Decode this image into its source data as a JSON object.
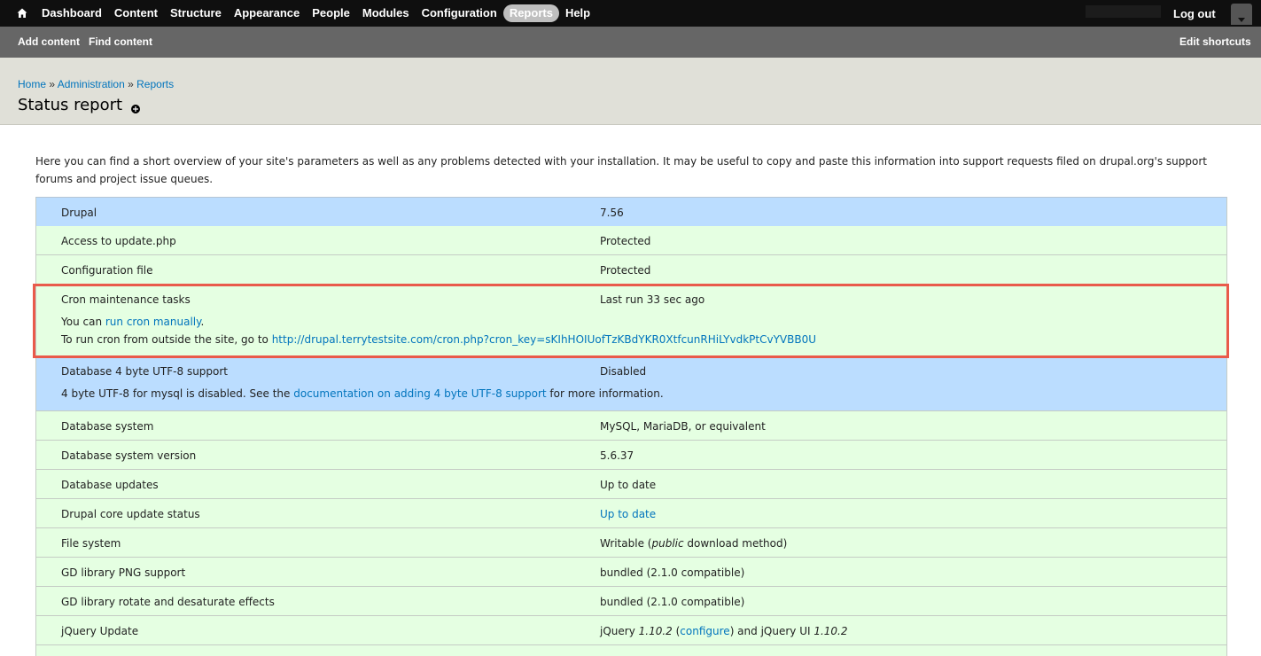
{
  "toolbar": {
    "menu": [
      "Dashboard",
      "Content",
      "Structure",
      "Appearance",
      "People",
      "Modules",
      "Configuration",
      "Reports",
      "Help"
    ],
    "active": "Reports",
    "logout": "Log out"
  },
  "shortcuts": {
    "add_content": "Add content",
    "find_content": "Find content",
    "edit_shortcuts": "Edit shortcuts"
  },
  "breadcrumb": {
    "home": "Home",
    "sep": "»",
    "administration": "Administration",
    "reports": "Reports"
  },
  "page_title": "Status report",
  "intro": "Here you can find a short overview of your site's parameters as well as any problems detected with your installation. It may be useful to copy and paste this information into support requests filed on drupal.org's support forums and project issue queues.",
  "rows": [
    {
      "title": "Drupal",
      "value": "7.56",
      "status": "info"
    },
    {
      "title": "Access to update.php",
      "value": "Protected",
      "status": "ok"
    },
    {
      "title": "Configuration file",
      "value": "Protected",
      "status": "ok"
    },
    {
      "title": "Cron maintenance tasks",
      "value": "Last run 33 sec ago",
      "status": "ok",
      "desc1_pre": "You can ",
      "desc1_link": "run cron manually",
      "desc1_post": ".",
      "desc2_pre": "To run cron from outside the site, go to ",
      "desc2_link": "http://drupal.terrytestsite.com/cron.php?cron_key=sKIhHOIUofTzKBdYKR0XtfcunRHiLYvdkPtCvYVBB0U"
    },
    {
      "title": "Database 4 byte UTF-8 support",
      "value": "Disabled",
      "status": "info",
      "desc_pre": "4 byte UTF-8 for mysql is disabled. See the ",
      "desc_link": "documentation on adding 4 byte UTF-8 support",
      "desc_post": " for more information."
    },
    {
      "title": "Database system",
      "value": "MySQL, MariaDB, or equivalent",
      "status": "ok"
    },
    {
      "title": "Database system version",
      "value": "5.6.37",
      "status": "ok"
    },
    {
      "title": "Database updates",
      "value": "Up to date",
      "status": "ok"
    },
    {
      "title": "Drupal core update status",
      "value": "Up to date",
      "status": "ok"
    },
    {
      "title": "File system",
      "value_pre": "Writable (",
      "value_em": "public",
      "value_post": " download method)",
      "status": "ok"
    },
    {
      "title": "GD library PNG support",
      "value": "bundled (2.1.0 compatible)",
      "status": "ok"
    },
    {
      "title": "GD library rotate and desaturate effects",
      "value": "bundled (2.1.0 compatible)",
      "status": "ok"
    },
    {
      "title": "jQuery Update",
      "value_pre": "jQuery ",
      "value_em1": "1.10.2",
      "value_mid1": " (",
      "value_link": "configure",
      "value_mid2": ") and jQuery UI ",
      "value_em2": "1.10.2",
      "status": "ok"
    }
  ],
  "colors": {
    "ok": "#e5ffe2",
    "info": "#bbddff",
    "link": "#0074bd",
    "highlight": "#e95a4b"
  },
  "icons": [
    "home-icon",
    "chevron-down-icon",
    "add-shortcut-icon"
  ]
}
